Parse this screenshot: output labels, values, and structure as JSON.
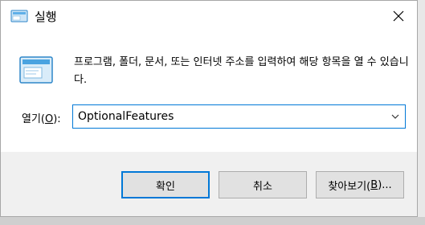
{
  "window": {
    "title": "실행",
    "description": "프로그램, 폴더, 문서, 또는 인터넷 주소를 입력하여 해당 항목을 열 수 있습니다."
  },
  "open": {
    "label": "열기(O):",
    "label_pre": "열기(",
    "label_key": "O",
    "label_post": "):",
    "value": "OptionalFeatures"
  },
  "buttons": {
    "ok": "확인",
    "cancel": "취소",
    "browse_pre": "찾아보기(",
    "browse_key": "B",
    "browse_post": ")..."
  },
  "icons": {
    "title": "run-icon",
    "close": "close-icon",
    "large": "run-large-icon",
    "dropdown": "chevron-down-icon"
  },
  "colors": {
    "accent": "#0078d7",
    "window_bg": "#f0f0f0",
    "content_bg": "#ffffff"
  }
}
